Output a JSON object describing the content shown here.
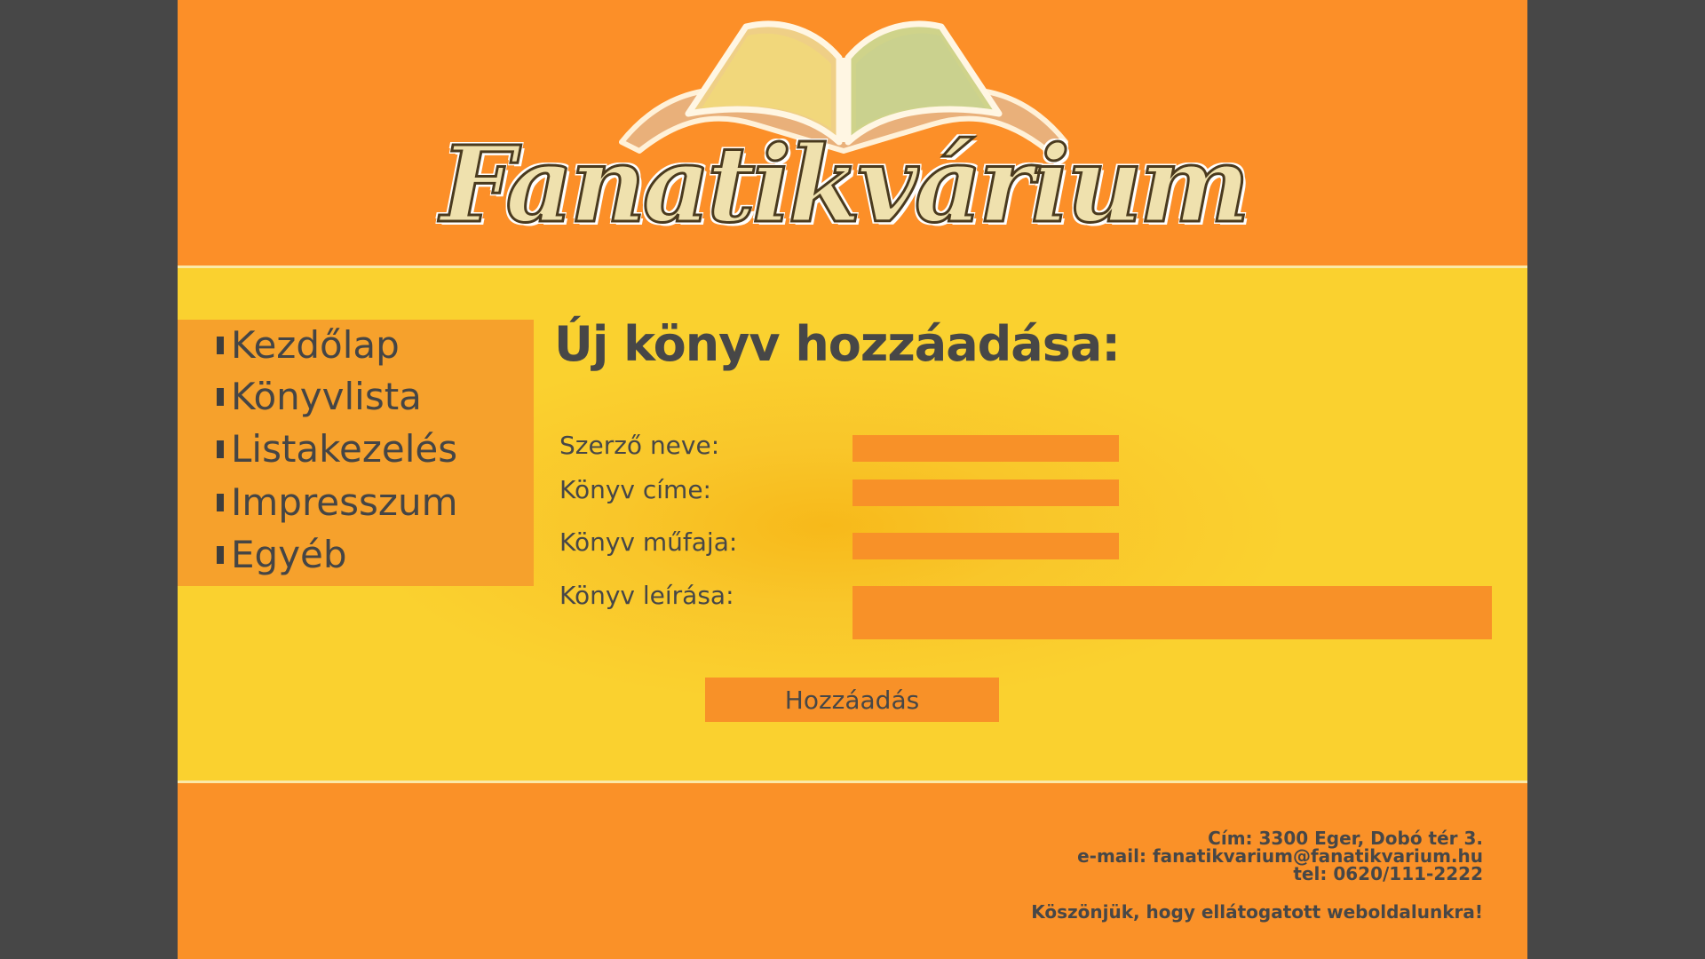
{
  "site": {
    "logo_text": "Fanatikvárium"
  },
  "nav": {
    "items": [
      {
        "label": "Kezdőlap"
      },
      {
        "label": "Könyvlista"
      },
      {
        "label": "Listakezelés"
      },
      {
        "label": "Impresszum"
      },
      {
        "label": "Egyéb"
      }
    ]
  },
  "form": {
    "title": "Új könyv hozzáadása:",
    "author_label": "Szerző neve:",
    "title_label": "Könyv címe:",
    "genre_label": "Könyv műfaja:",
    "description_label": "Könyv leírása:",
    "author_value": "",
    "title_value": "",
    "genre_value": "",
    "description_value": "",
    "submit_label": "Hozzáadás"
  },
  "footer": {
    "address": "Cím: 3300 Eger, Dobó tér 3.",
    "email": "e-mail: fanatikvarium@fanatikvarium.hu",
    "phone": "tel: 0620/111-2222",
    "thanks": "Köszönjük, hogy ellátogatott weboldalunkra!"
  },
  "colors": {
    "background": "#474747",
    "header_orange": "#fc8f28",
    "main_yellow": "#fad12f",
    "input_orange": "#f89128",
    "text_dark": "#474747"
  }
}
